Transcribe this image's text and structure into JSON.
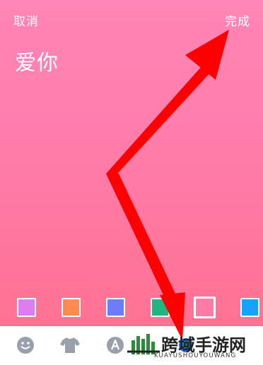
{
  "header": {
    "cancel_label": "取消",
    "done_label": "完成"
  },
  "editor": {
    "text": "爱你"
  },
  "palette": {
    "swatches": [
      {
        "name": "violet",
        "color": "#de7df0"
      },
      {
        "name": "orange",
        "color": "#ff8a4f"
      },
      {
        "name": "blue",
        "color": "#6c7df7"
      },
      {
        "name": "green",
        "color": "#1fb77f"
      },
      {
        "name": "pink",
        "color": "#ff7aa6",
        "selected": true
      },
      {
        "name": "sky-blue",
        "color": "#16a3ff"
      }
    ]
  },
  "toolbar": {
    "icons": [
      "emoji-icon",
      "tshirt-icon",
      "font-a-icon",
      "color-dot-icon"
    ]
  },
  "watermark": {
    "title": "跨域手游网",
    "subtitle": "KUAYUSHOUYOUWANG"
  },
  "colors": {
    "arrow": "#ff0000",
    "background_top": "#ff86b6",
    "background_bottom": "#ff7292"
  }
}
